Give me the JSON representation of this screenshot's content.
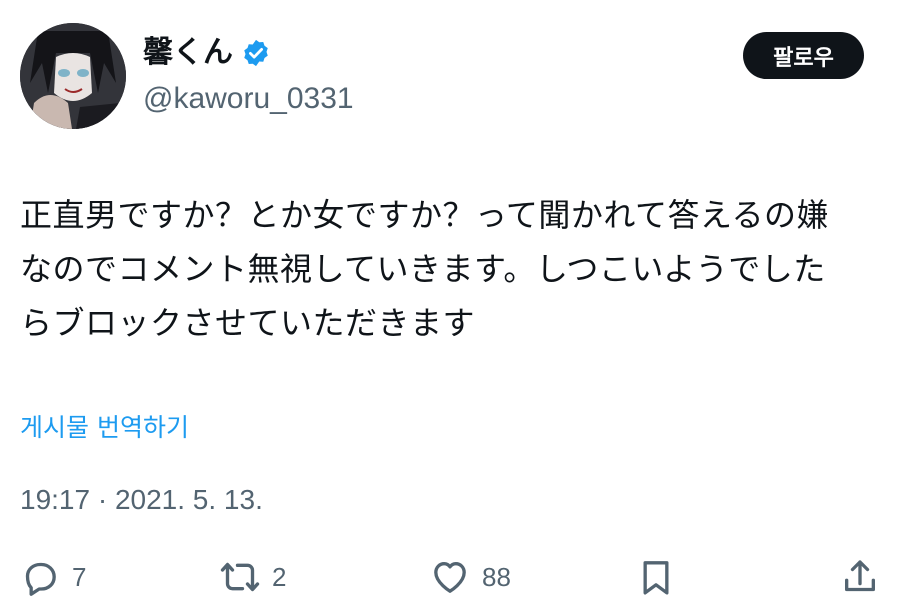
{
  "author": {
    "display_name": "馨くん",
    "handle": "@kaworu_0331",
    "verified_icon": "verified-badge-icon"
  },
  "follow_button": {
    "label": "팔로우"
  },
  "tweet": {
    "lines": [
      "正直男ですか？とか女ですか？って聞かれて答えるの嫌",
      "なのでコメント無視していきます。しつこいようでした",
      "らブロックさせていただきます"
    ],
    "translate_label": "게시물 번역하기",
    "timestamp": "19:17 · 2021. 5. 13."
  },
  "actions": {
    "reply": {
      "icon": "reply-icon",
      "count": "7"
    },
    "retweet": {
      "icon": "retweet-icon",
      "count": "2"
    },
    "like": {
      "icon": "heart-icon",
      "count": "88"
    },
    "bookmark": {
      "icon": "bookmark-icon"
    },
    "share": {
      "icon": "share-icon"
    }
  },
  "colors": {
    "text": "#0f1419",
    "secondary": "#536471",
    "link": "#1d9bf0",
    "verified": "#1d9bf0",
    "button_bg": "#0f1419"
  }
}
